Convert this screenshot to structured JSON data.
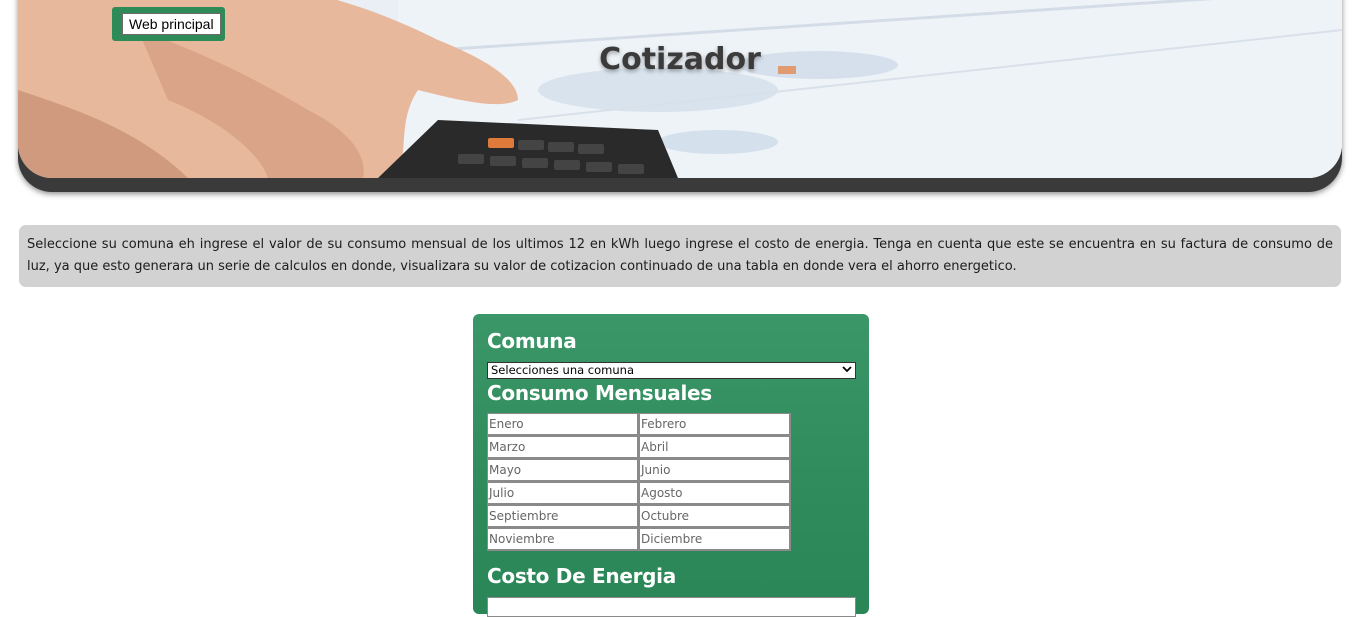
{
  "header": {
    "title": "Cotizador",
    "back_button_label": "Web principal"
  },
  "info": {
    "text": "Seleccione su comuna eh ingrese el valor de su consumo mensual de los ultimos 12 en kWh luego ingrese el costo de energia. Tenga en cuenta que este se encuentra en su factura de consumo de luz, ya que esto generara un serie de calculos en donde, visualizara su valor de cotizacion continuado de una tabla en donde vera el ahorro energetico."
  },
  "form": {
    "comuna_heading": "Comuna",
    "comuna_select_value": "Selecciones una comuna",
    "consumo_heading": "Consumo Mensuales",
    "months": [
      "Enero",
      "Febrero",
      "Marzo",
      "Abril",
      "Mayo",
      "Junio",
      "Julio",
      "Agosto",
      "Septiembre",
      "Octubre",
      "Noviembre",
      "Diciembre"
    ],
    "costo_heading": "Costo De Energia"
  },
  "colors": {
    "card_green": "#2f8b5b",
    "info_background": "#d3d2d3",
    "button_frame": "#2e8a57"
  },
  "icons": {
    "select_arrow": "chevron-down-icon"
  }
}
